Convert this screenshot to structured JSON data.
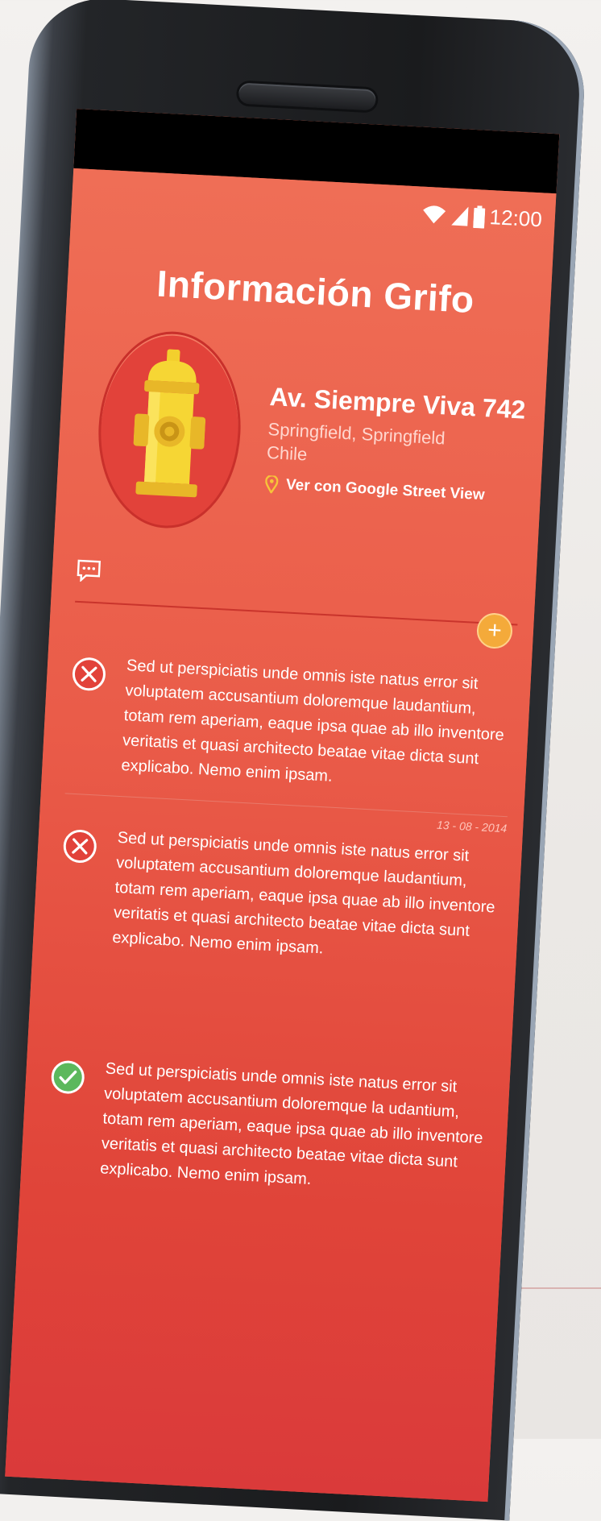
{
  "status_bar": {
    "time": "12:00",
    "wifi_icon": "wifi-icon",
    "signal_icon": "signal-icon",
    "battery_icon": "battery-icon"
  },
  "page": {
    "title": "Información Grifo"
  },
  "hydrant": {
    "icon": "fire-hydrant-icon",
    "street": "Av. Siempre Viva 742",
    "city_line1": "Springfield, Springfield",
    "city_line2": "Chile",
    "street_view_label": "Ver con Google Street View",
    "pin_icon": "map-pin-icon"
  },
  "comments_header": {
    "icon": "comment-icon",
    "add_icon": "plus-icon"
  },
  "colors": {
    "background": "#ea5c49",
    "accent_add": "#f4aa3a",
    "status_error": "#e2423a",
    "status_ok": "#5cb85c"
  },
  "comments": [
    {
      "status": "error",
      "icon": "x-circle-icon",
      "text": "Sed ut perspiciatis unde omnis iste natus error sit voluptatem accusantium doloremque laudantium, totam rem aperiam, eaque ipsa quae ab illo inventore veritatis et quasi architecto beatae vitae dicta sunt explicabo. Nemo enim ipsam.",
      "date": "13 - 08 - 2014"
    },
    {
      "status": "error",
      "icon": "x-circle-icon",
      "text": "Sed ut perspiciatis unde omnis iste natus error sit voluptatem accusantium doloremque laudantium, totam rem aperiam, eaque ipsa quae ab illo inventore veritatis et quasi architecto beatae vitae dicta sunt explicabo. Nemo enim ipsam.",
      "date": ""
    },
    {
      "status": "ok",
      "icon": "check-circle-icon",
      "text": "Sed ut perspiciatis unde omnis iste natus error sit voluptatem accusantium doloremque la udantium, totam rem aperiam, eaque ipsa quae ab illo inventore veritatis et quasi architecto beatae vitae dicta sunt explicabo. Nemo enim ipsam.",
      "date": ""
    }
  ]
}
